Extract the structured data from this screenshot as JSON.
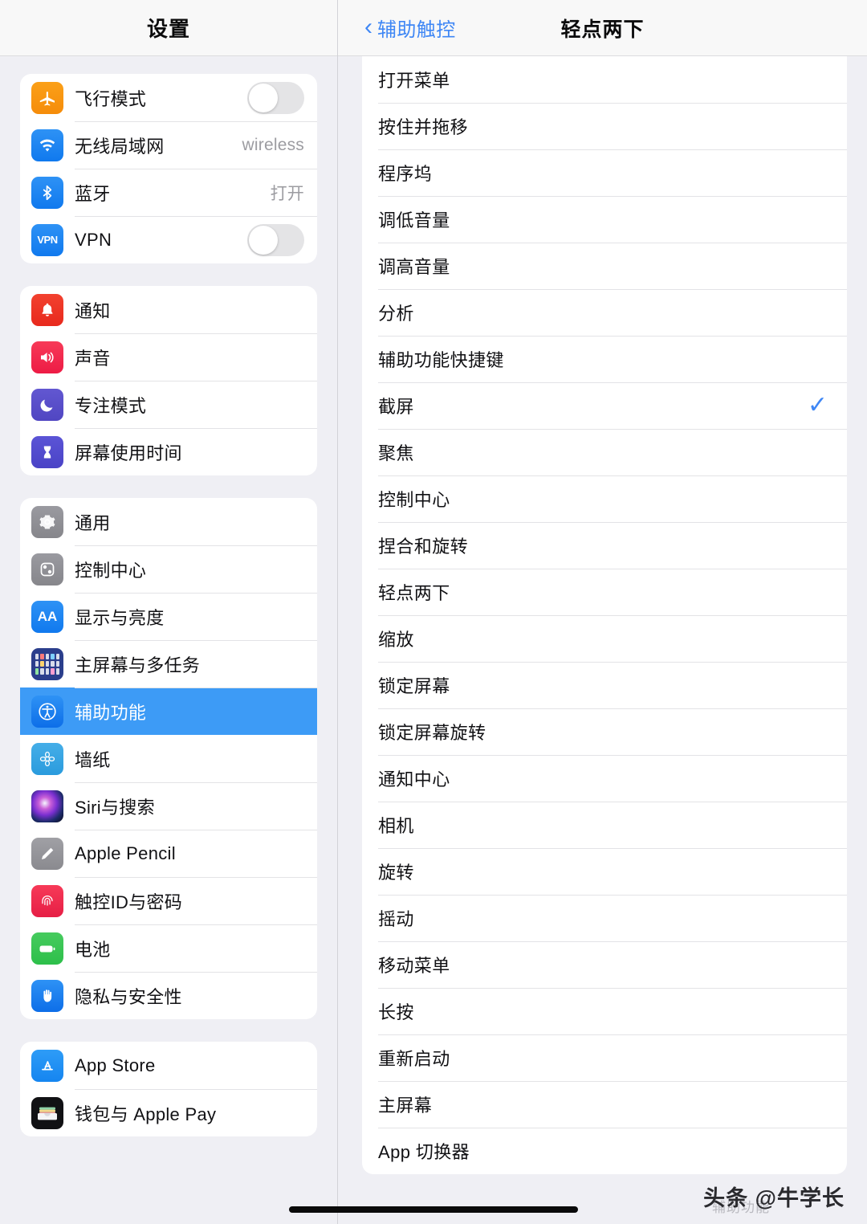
{
  "sidebar": {
    "title": "设置",
    "groups": [
      {
        "items": [
          {
            "label": "飞行模式",
            "icon": "airplane-icon",
            "control": "toggle",
            "toggle_on": false
          },
          {
            "label": "无线局域网",
            "icon": "wifi-icon",
            "control": "value",
            "value": "wireless"
          },
          {
            "label": "蓝牙",
            "icon": "bluetooth-icon",
            "control": "value",
            "value": "打开"
          },
          {
            "label": "VPN",
            "icon": "vpn-icon",
            "control": "toggle",
            "toggle_on": false
          }
        ]
      },
      {
        "items": [
          {
            "label": "通知",
            "icon": "bell-icon",
            "control": "none"
          },
          {
            "label": "声音",
            "icon": "speaker-icon",
            "control": "none"
          },
          {
            "label": "专注模式",
            "icon": "moon-icon",
            "control": "none"
          },
          {
            "label": "屏幕使用时间",
            "icon": "hourglass-icon",
            "control": "none"
          }
        ]
      },
      {
        "items": [
          {
            "label": "通用",
            "icon": "gear-icon",
            "control": "none"
          },
          {
            "label": "控制中心",
            "icon": "sliders-icon",
            "control": "none"
          },
          {
            "label": "显示与亮度",
            "icon": "aa-icon",
            "control": "none"
          },
          {
            "label": "主屏幕与多任务",
            "icon": "home-grid-icon",
            "control": "none"
          },
          {
            "label": "辅助功能",
            "icon": "accessibility-icon",
            "control": "none",
            "selected": true
          },
          {
            "label": "墙纸",
            "icon": "flower-icon",
            "control": "none"
          },
          {
            "label": "Siri与搜索",
            "icon": "siri-icon",
            "control": "none"
          },
          {
            "label": "Apple Pencil",
            "icon": "pencil-icon",
            "control": "none"
          },
          {
            "label": "触控ID与密码",
            "icon": "fingerprint-icon",
            "control": "none"
          },
          {
            "label": "电池",
            "icon": "battery-icon",
            "control": "none"
          },
          {
            "label": "隐私与安全性",
            "icon": "hand-icon",
            "control": "none"
          }
        ]
      },
      {
        "items": [
          {
            "label": "App Store",
            "icon": "appstore-icon",
            "control": "none"
          },
          {
            "label": "钱包与 Apple Pay",
            "icon": "wallet-icon",
            "control": "none"
          }
        ]
      }
    ]
  },
  "detail": {
    "back_label": "辅助触控",
    "back_icon": "chevron-left-icon",
    "title": "轻点两下",
    "checkmark_icon": "checkmark-icon",
    "options": [
      {
        "label": "打开菜单",
        "checked": false
      },
      {
        "label": "按住并拖移",
        "checked": false
      },
      {
        "label": "程序坞",
        "checked": false
      },
      {
        "label": "调低音量",
        "checked": false
      },
      {
        "label": "调高音量",
        "checked": false
      },
      {
        "label": "分析",
        "checked": false
      },
      {
        "label": "辅助功能快捷键",
        "checked": false
      },
      {
        "label": "截屏",
        "checked": true
      },
      {
        "label": "聚焦",
        "checked": false
      },
      {
        "label": "控制中心",
        "checked": false
      },
      {
        "label": "捏合和旋转",
        "checked": false
      },
      {
        "label": "轻点两下",
        "checked": false
      },
      {
        "label": "缩放",
        "checked": false
      },
      {
        "label": "锁定屏幕",
        "checked": false
      },
      {
        "label": "锁定屏幕旋转",
        "checked": false
      },
      {
        "label": "通知中心",
        "checked": false
      },
      {
        "label": "相机",
        "checked": false
      },
      {
        "label": "旋转",
        "checked": false
      },
      {
        "label": "摇动",
        "checked": false
      },
      {
        "label": "移动菜单",
        "checked": false
      },
      {
        "label": "长按",
        "checked": false
      },
      {
        "label": "重新启动",
        "checked": false
      },
      {
        "label": "主屏幕",
        "checked": false
      },
      {
        "label": "App 切换器",
        "checked": false
      }
    ]
  },
  "overlay": {
    "ghost_text": "辅助功能",
    "watermark": "头条 @牛学长"
  },
  "colors": {
    "accent": "#3F87F5",
    "selection": "#3D9BF6",
    "background": "#EFEFF4",
    "card": "#FFFFFF",
    "separator": "#E3E3E6",
    "secondary_text": "#9C9CA1"
  }
}
